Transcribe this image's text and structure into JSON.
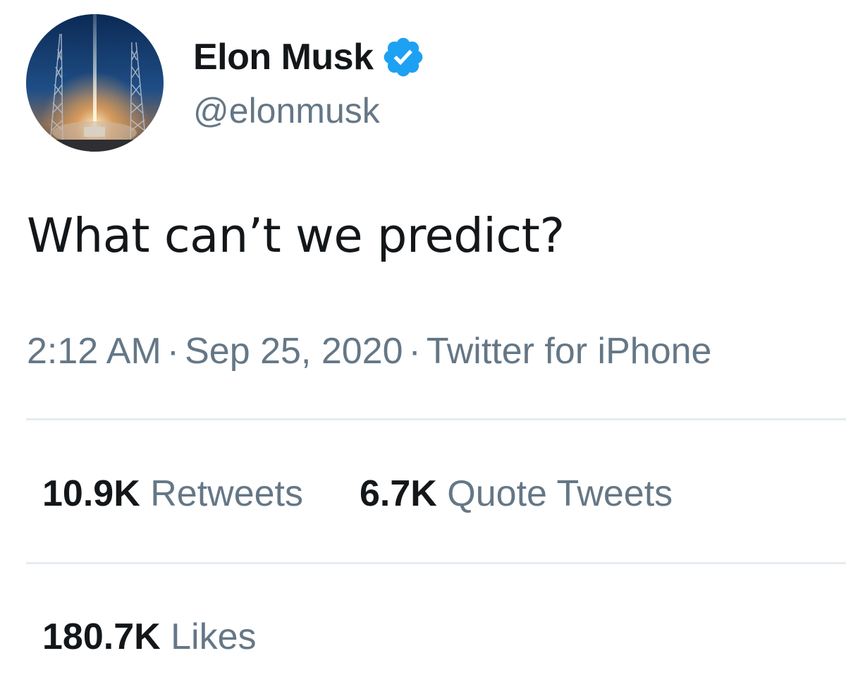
{
  "author": {
    "display_name": "Elon Musk",
    "handle": "@elonmusk",
    "verified": true,
    "avatar_icon": "rocket-launch-avatar"
  },
  "tweet": {
    "text": "What can’t we predict?"
  },
  "meta": {
    "time": "2:12 AM",
    "separator": "·",
    "date": "Sep 25, 2020",
    "source": "Twitter for iPhone"
  },
  "stats": {
    "retweets": {
      "count": "10.9K",
      "label": "Retweets"
    },
    "quote_tweets": {
      "count": "6.7K",
      "label": "Quote Tweets"
    },
    "likes": {
      "count": "180.7K",
      "label": "Likes"
    }
  },
  "colors": {
    "primary_text": "#14171a",
    "secondary_text": "#657786",
    "verified_blue": "#1da1f2",
    "divider": "#e6ecf0"
  }
}
